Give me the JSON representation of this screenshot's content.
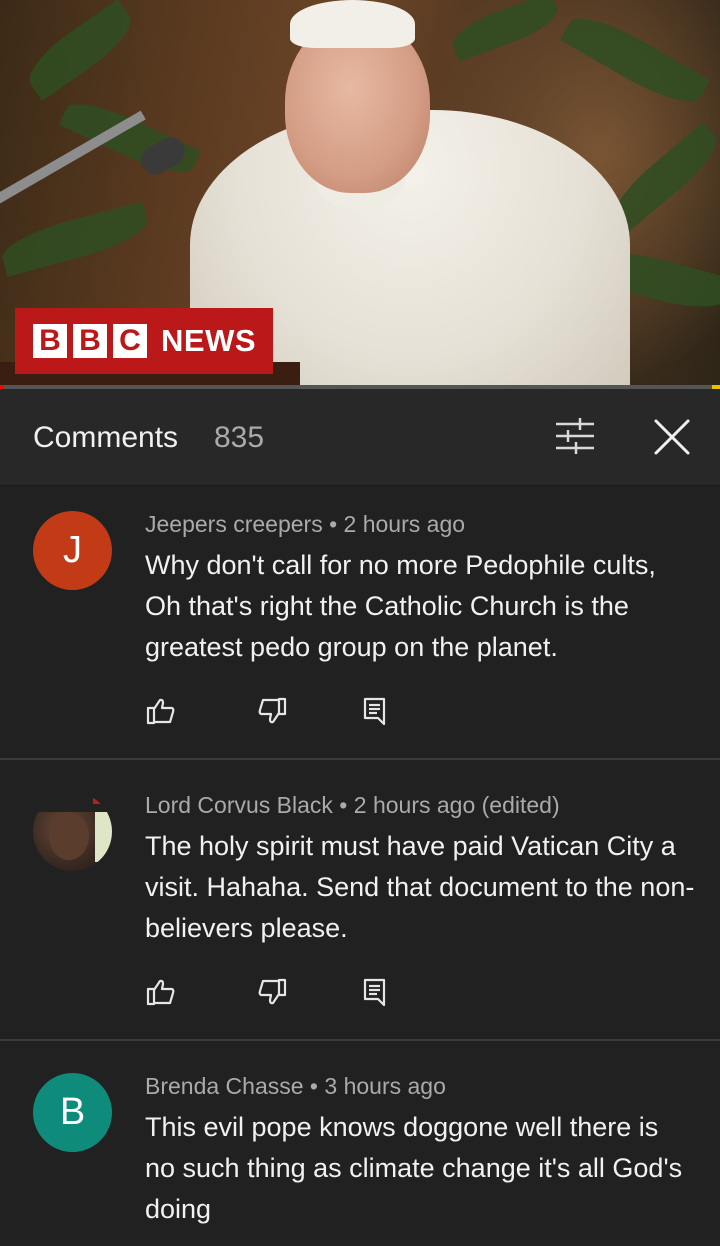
{
  "video": {
    "logo_letters": [
      "B",
      "B",
      "C"
    ],
    "logo_text": "NEWS",
    "progress_fraction": 0.005,
    "colors": {
      "logo_red": "#bb1919",
      "progress": "#ff0000"
    }
  },
  "comments_header": {
    "title": "Comments",
    "count": "835",
    "filter_icon": "sliders-icon",
    "close_icon": "close-icon"
  },
  "comments": [
    {
      "avatar_letter": "J",
      "avatar_color": "#c23b16",
      "author": "Jeepers creepers",
      "separator": " • ",
      "time": "2 hours ago",
      "text": "Why don't call for no more Pedophile cults, Oh that's right the Catholic Church is the greatest pedo group on the planet."
    },
    {
      "avatar_letter": "",
      "avatar_color": "#4a3a30",
      "author": "Lord Corvus Black",
      "separator": " • ",
      "time": "2 hours ago (edited)",
      "text": "The holy spirit must have paid  Vatican City a visit. Hahaha. Send that document to the non-believers please."
    },
    {
      "avatar_letter": "B",
      "avatar_color": "#0f8b7c",
      "author": "Brenda Chasse",
      "separator": " • ",
      "time": "3 hours ago",
      "text": "This evil pope knows doggone well there is no such thing as climate change it's all God's doing"
    }
  ]
}
